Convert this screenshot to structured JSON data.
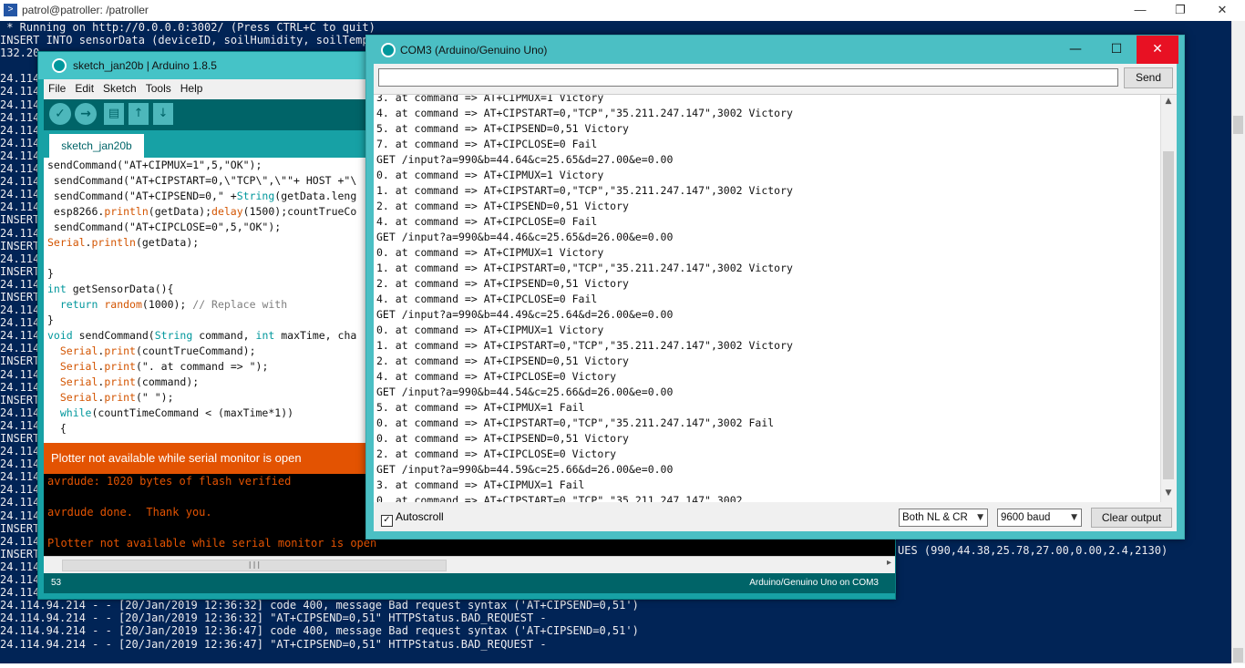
{
  "powershell": {
    "title": "patrol@patroller: /patroller",
    "icon": "powershell-icon",
    "controls": [
      "—",
      "❐",
      "✕"
    ],
    "lines": [
      " * Running on http://0.0.0.0:3002/ (Press CTRL+C to quit)",
      "INSERT INTO sensorData (deviceID, soilHumidity, soilTempe",
      "132.20",
      "",
      "24.114",
      "24.114",
      "24.114",
      "24.114",
      "24.114",
      "24.114",
      "24.114",
      "24.114",
      "24.114",
      "24.114",
      "24.114",
      "INSERT",
      "24.114",
      "INSERT",
      "24.114",
      "INSERT",
      "24.114",
      "INSERT",
      "24.114",
      "24.114",
      "24.114",
      "24.114",
      "INSERT",
      "24.114",
      "24.114",
      "INSERT",
      "24.114",
      "24.114",
      "INSERT",
      "24.114",
      "24.114",
      "24.114",
      "24.114",
      "24.114",
      "24.114",
      "INSERT",
      "24.114",
      "INSERT",
      "24.114",
      "24.114",
      "24.114",
      "24.114.94.214 - - [20/Jan/2019 12:36:32] code 400, message Bad request syntax ('AT+CIPSEND=0,51')",
      "24.114.94.214 - - [20/Jan/2019 12:36:32] \"AT+CIPSEND=0,51\" HTTPStatus.BAD_REQUEST -",
      "24.114.94.214 - - [20/Jan/2019 12:36:47] code 400, message Bad request syntax ('AT+CIPSEND=0,51')",
      "24.114.94.214 - - [20/Jan/2019 12:36:47] \"AT+CIPSEND=0,51\" HTTPStatus.BAD_REQUEST -"
    ],
    "values_fragment": "UES (990,44.38,25.78,27.00,0.00,2.4,2130)"
  },
  "ide": {
    "title": "sketch_jan20b | Arduino 1.8.5",
    "menu": [
      "File",
      "Edit",
      "Sketch",
      "Tools",
      "Help"
    ],
    "tab": "sketch_jan20b",
    "code": [
      "sendCommand(\"AT+CIPMUX=1\",5,\"OK\");",
      " sendCommand(\"AT+CIPSTART=0,\\\"TCP\\\",\\\"\"+ HOST +\"\\",
      " sendCommand(\"AT+CIPSEND=0,\" +String(getData.leng",
      " esp8266.println(getData);delay(1500);countTrueCo",
      " sendCommand(\"AT+CIPCLOSE=0\",5,\"OK\");",
      "Serial.println(getData);",
      "",
      "}",
      "int getSensorData(){",
      "  return random(1000); // Replace with",
      "}",
      "void sendCommand(String command, int maxTime, cha",
      "  Serial.print(countTrueCommand);",
      "  Serial.print(\". at command => \");",
      "  Serial.print(command);",
      "  Serial.print(\" \");",
      "  while(countTimeCommand < (maxTime*1))",
      "  {"
    ],
    "notice": "Plotter not available while serial monitor is open",
    "console": [
      "avrdude: 1020 bytes of flash verified",
      "",
      "avrdude done.  Thank you.",
      "",
      "Plotter not available while serial monitor is open"
    ],
    "status_line": "53",
    "status_board": "Arduino/Genuino Uno on COM3"
  },
  "serial_monitor": {
    "title": "COM3 (Arduino/Genuino Uno)",
    "controls": [
      "—",
      "☐",
      "✕"
    ],
    "input_value": "",
    "send_label": "Send",
    "output": [
      "3. at command => AT+CIPMUX=1 Victory",
      "4. at command => AT+CIPSTART=0,\"TCP\",\"35.211.247.147\",3002 Victory",
      "5. at command => AT+CIPSEND=0,51 Victory",
      "7. at command => AT+CIPCLOSE=0 Fail",
      "GET /input?a=990&b=44.64&c=25.65&d=27.00&e=0.00",
      "0. at command => AT+CIPMUX=1 Victory",
      "1. at command => AT+CIPSTART=0,\"TCP\",\"35.211.247.147\",3002 Victory",
      "2. at command => AT+CIPSEND=0,51 Victory",
      "4. at command => AT+CIPCLOSE=0 Fail",
      "GET /input?a=990&b=44.46&c=25.65&d=26.00&e=0.00",
      "0. at command => AT+CIPMUX=1 Victory",
      "1. at command => AT+CIPSTART=0,\"TCP\",\"35.211.247.147\",3002 Victory",
      "2. at command => AT+CIPSEND=0,51 Victory",
      "4. at command => AT+CIPCLOSE=0 Fail",
      "GET /input?a=990&b=44.49&c=25.64&d=26.00&e=0.00",
      "0. at command => AT+CIPMUX=1 Victory",
      "1. at command => AT+CIPSTART=0,\"TCP\",\"35.211.247.147\",3002 Victory",
      "2. at command => AT+CIPSEND=0,51 Victory",
      "4. at command => AT+CIPCLOSE=0 Victory",
      "GET /input?a=990&b=44.54&c=25.66&d=26.00&e=0.00",
      "5. at command => AT+CIPMUX=1 Fail",
      "0. at command => AT+CIPSTART=0,\"TCP\",\"35.211.247.147\",3002 Fail",
      "0. at command => AT+CIPSEND=0,51 Victory",
      "2. at command => AT+CIPCLOSE=0 Victory",
      "GET /input?a=990&b=44.59&c=25.66&d=26.00&e=0.00",
      "3. at command => AT+CIPMUX=1 Fail",
      "0. at command => AT+CIPSTART=0,\"TCP\",\"35.211.247.147\",3002"
    ],
    "autoscroll_label": "Autoscroll",
    "autoscroll_checked": true,
    "line_ending": "Both NL & CR",
    "baud": "9600 baud",
    "clear_label": "Clear output"
  }
}
